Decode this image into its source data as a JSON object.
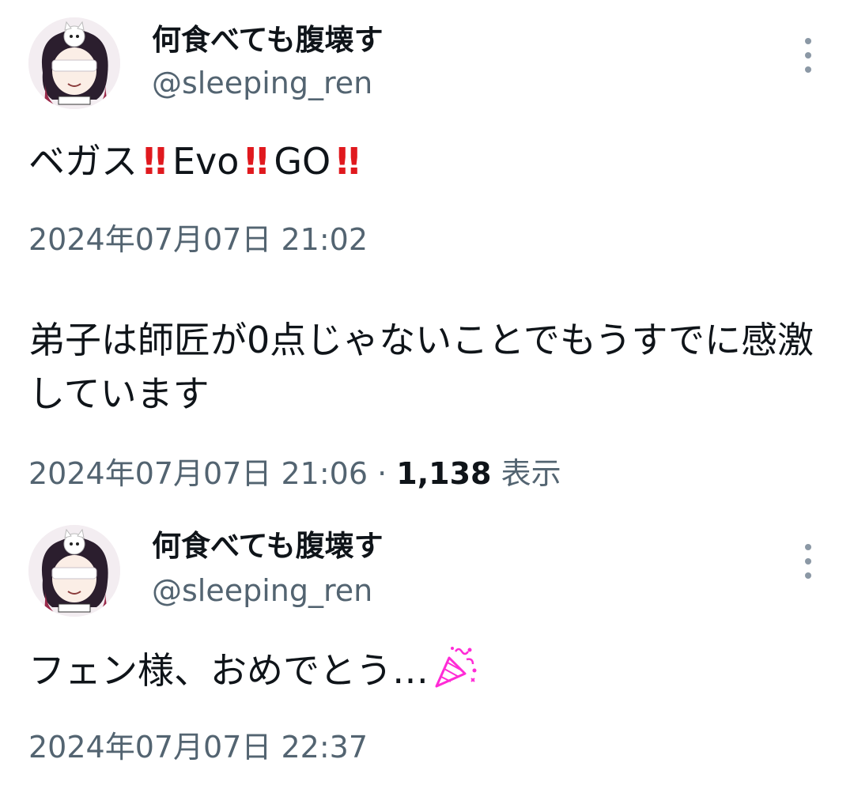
{
  "tweets": [
    {
      "author": {
        "name": "何食べても腹壊す",
        "handle": "@sleeping_ren",
        "avatar": "anime-avatar-image"
      },
      "text_parts": [
        "ベガス",
        "!!",
        "Evo",
        "!!",
        "GO",
        "!!"
      ],
      "timestamp": "2024年07月07日 21:02"
    },
    {
      "text": "弟子は師匠が0点じゃないことでもうすでに感激しています",
      "timestamp": "2024年07月07日 21:06",
      "separator": "·",
      "views_count": "1,138",
      "views_label": "表示"
    },
    {
      "author": {
        "name": "何食べても腹壊す",
        "handle": "@sleeping_ren",
        "avatar": "anime-avatar-image"
      },
      "text": "フェン様、おめでとう…",
      "emoji": "party-popper-icon",
      "timestamp": "2024年07月07日 22:37"
    }
  ],
  "icons": {
    "more": "more-vertical-icon"
  },
  "colors": {
    "accent_red": "#e0191e",
    "secondary_text": "#536471",
    "party": "#ff2bd6"
  }
}
